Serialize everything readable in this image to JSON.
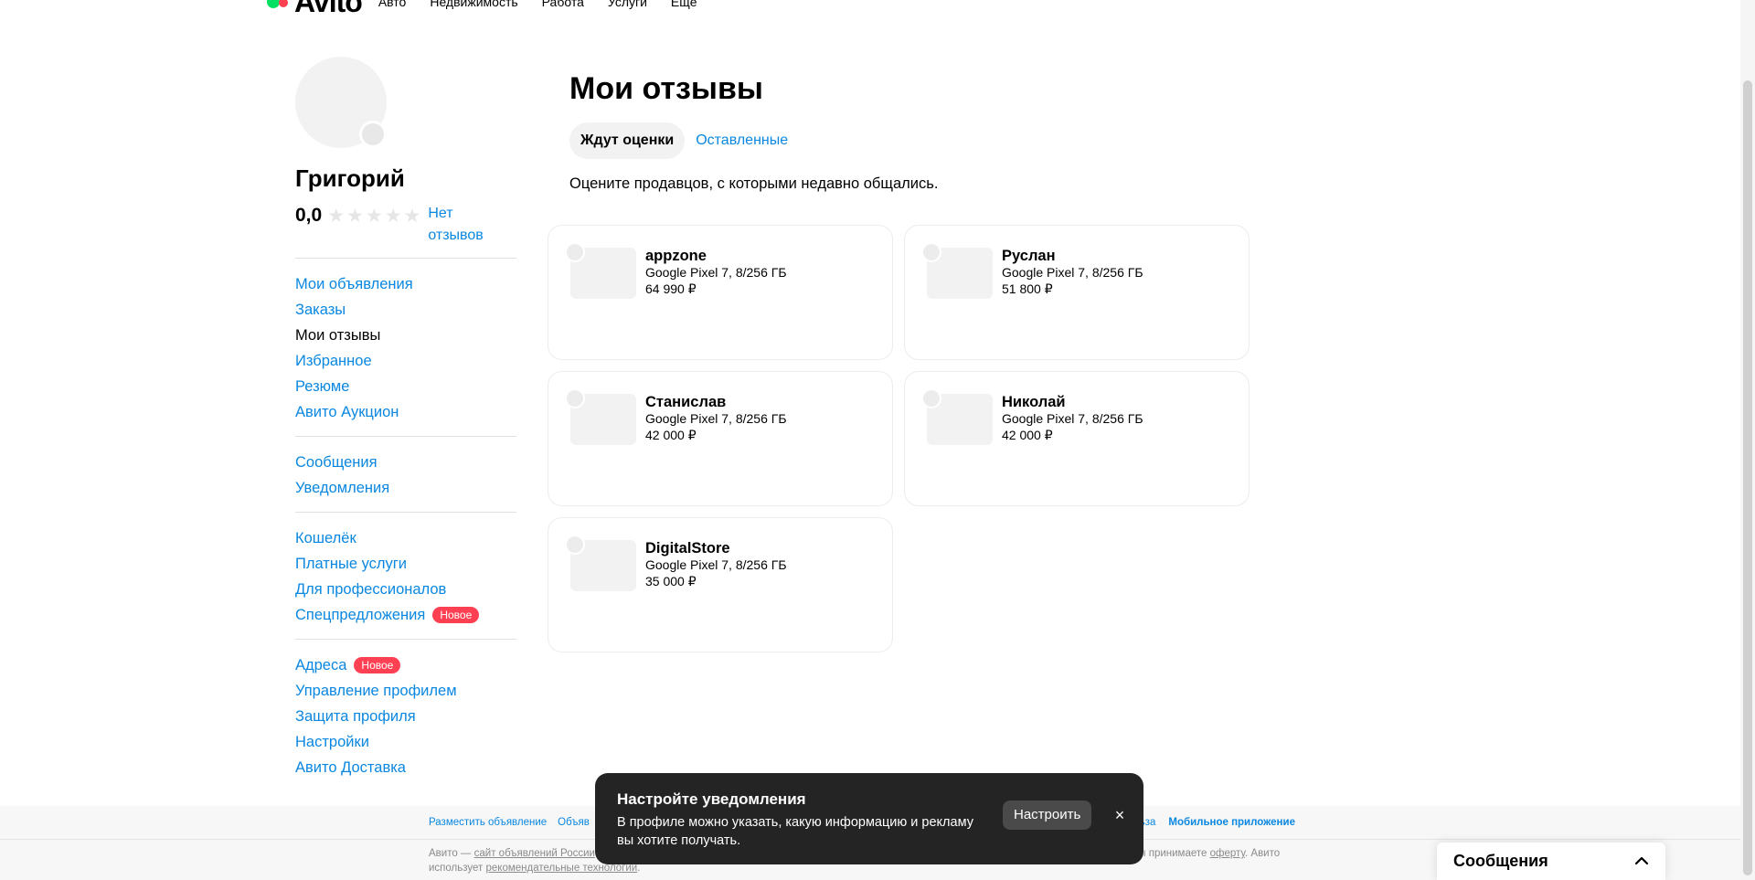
{
  "header": {
    "logo_text": "Avito",
    "nav": [
      "Авто",
      "Недвижимость",
      "Работа",
      "Услуги",
      "Ещё"
    ]
  },
  "sidebar": {
    "user_name": "Григорий",
    "rating_value": "0,0",
    "rating_stars": 0,
    "no_reviews_label": "Нет отзывов",
    "groups": [
      [
        {
          "label": "Мои объявления"
        },
        {
          "label": "Заказы"
        },
        {
          "label": "Мои отзывы",
          "active": true
        },
        {
          "label": "Избранное"
        },
        {
          "label": "Резюме"
        },
        {
          "label": "Авито Аукцион"
        }
      ],
      [
        {
          "label": "Сообщения"
        },
        {
          "label": "Уведомления"
        }
      ],
      [
        {
          "label": "Кошелёк"
        },
        {
          "label": "Платные услуги"
        },
        {
          "label": "Для профессионалов"
        },
        {
          "label": "Спецпредложения",
          "badge": "Новое"
        }
      ],
      [
        {
          "label": "Адреса",
          "badge": "Новое"
        },
        {
          "label": "Управление профилем"
        },
        {
          "label": "Защита профиля"
        },
        {
          "label": "Настройки"
        },
        {
          "label": "Авито Доставка"
        }
      ]
    ]
  },
  "main": {
    "title": "Мои отзывы",
    "tabs": [
      {
        "label": "Ждут оценки",
        "active": true
      },
      {
        "label": "Оставленные",
        "active": false
      }
    ],
    "hint": "Оцените продавцов, с которыми недавно общались.",
    "cards": [
      {
        "seller": "appzone",
        "product": "Google Pixel 7, 8/256 ГБ",
        "price": "64 990 ₽"
      },
      {
        "seller": "Руслан",
        "product": "Google Pixel 7, 8/256 ГБ",
        "price": "51 800 ₽"
      },
      {
        "seller": "Станислав",
        "product": "Google Pixel 7, 8/256 ГБ",
        "price": "42 000 ₽"
      },
      {
        "seller": "Николай",
        "product": "Google Pixel 7, 8/256 ГБ",
        "price": "42 000 ₽"
      },
      {
        "seller": "DigitalStore",
        "product": "Google Pixel 7, 8/256 ГБ",
        "price": "35 000 ₽"
      }
    ]
  },
  "footer": {
    "links_left": [
      "Разместить объявление",
      "Объяв"
    ],
    "links_right_partial": "льза",
    "mobile_app": "Мобильное приложение",
    "legal_prefix": "Авито — ",
    "legal_link": "сайт объявлений России",
    "legal_suffix": ".",
    "legal_line2_prefix": "использует ",
    "legal_line2_link": "рекомендательные технологии",
    "legal_line2_suffix": ".",
    "legal_right_prefix": "зы принимаете ",
    "legal_right_link": "оферту",
    "legal_right_suffix": ". Авито"
  },
  "toast": {
    "title": "Настройте уведомления",
    "text": "В профиле можно указать, какую информацию и рекламу вы хотите получать.",
    "button": "Настроить",
    "close": "×"
  },
  "messenger": {
    "title": "Сообщения"
  }
}
